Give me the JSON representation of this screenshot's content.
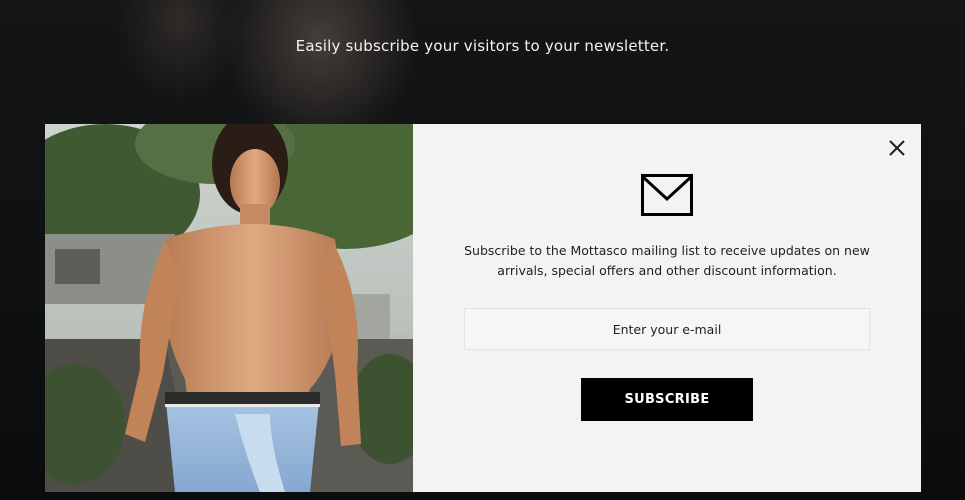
{
  "background": {
    "caption": "Easily subscribe your visitors to your newsletter."
  },
  "popup": {
    "description": "Subscribe to the Mottasco mailing list to receive updates on new arrivals, special offers and other discount information.",
    "email_placeholder": "Enter your e-mail",
    "subscribe_label": "SUBSCRIBE",
    "close_icon": "close-icon",
    "mail_icon": "envelope-icon"
  },
  "colors": {
    "button_bg": "#000000",
    "panel_bg": "#f3f3f3",
    "page_bg": "#0d0e10"
  }
}
